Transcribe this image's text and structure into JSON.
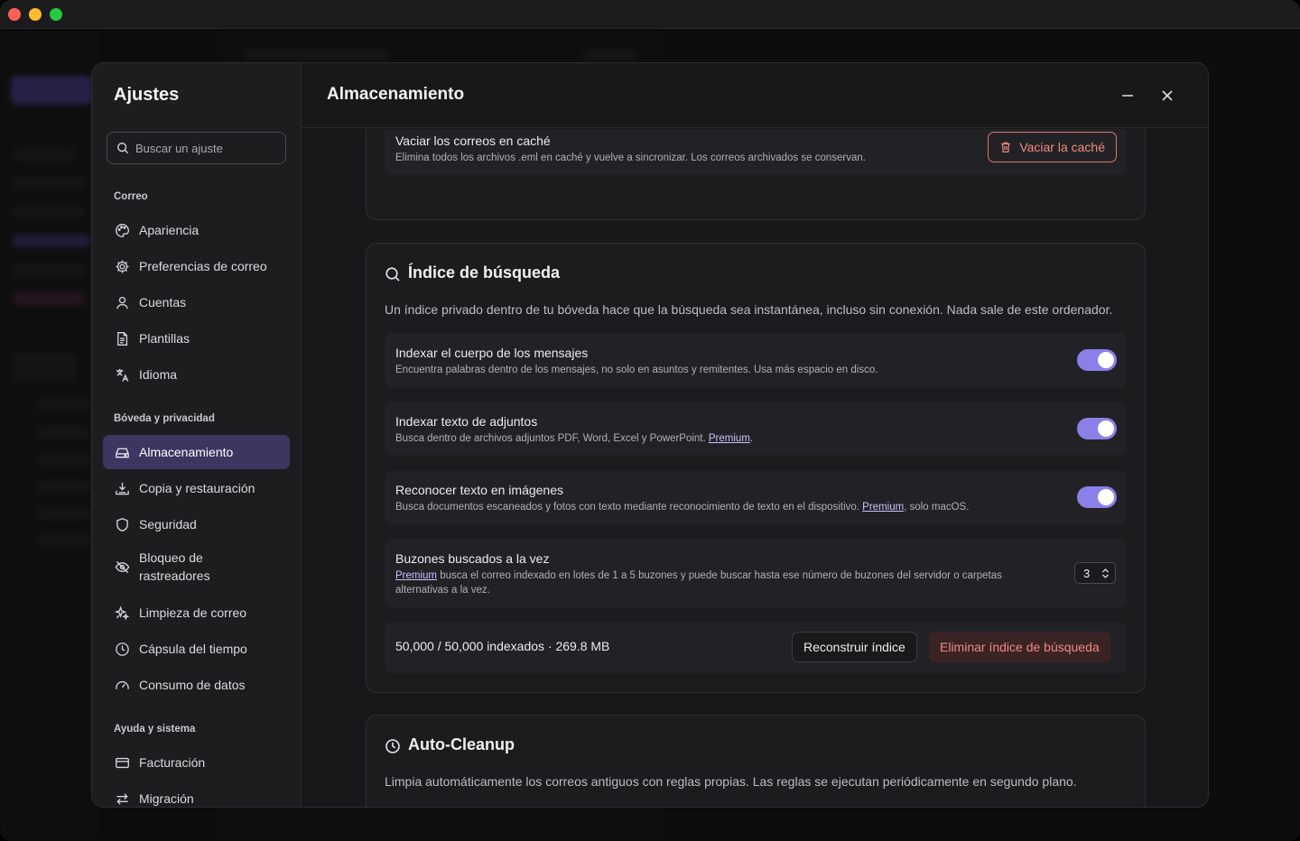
{
  "settings": {
    "title": "Ajustes",
    "search_placeholder": "Buscar un ajuste",
    "sections": [
      {
        "label": "Correo"
      },
      {
        "label": "Bóveda y privacidad"
      },
      {
        "label": "Ayuda y sistema"
      }
    ],
    "nav": {
      "apariencia": "Apariencia",
      "preferencias": "Preferencias de correo",
      "cuentas": "Cuentas",
      "plantillas": "Plantillas",
      "idioma": "Idioma",
      "almacenamiento": "Almacenamiento",
      "copia": "Copia y restauración",
      "seguridad": "Seguridad",
      "bloqueo": "Bloqueo de rastreadores",
      "limpieza": "Limpieza de correo",
      "capsula": "Cápsula del tiempo",
      "consumo": "Consumo de datos",
      "facturacion": "Facturación",
      "migracion": "Migración"
    }
  },
  "page": {
    "title": "Almacenamiento"
  },
  "cache": {
    "title": "Vaciar los correos en caché",
    "desc": "Elimina todos los archivos .eml en caché y vuelve a sincronizar. Los correos archivados se conservan.",
    "button": "Vaciar la caché"
  },
  "search_index": {
    "title": "Índice de búsqueda",
    "desc": "Un índice privado dentro de tu bóveda hace que la búsqueda sea instantánea, incluso sin conexión. Nada sale de este ordenador.",
    "body": {
      "title": "Indexar el cuerpo de los mensajes",
      "desc": "Encuentra palabras dentro de los mensajes, no solo en asuntos y remitentes. Usa más espacio en disco.",
      "enabled": true
    },
    "attachments": {
      "title": "Indexar texto de adjuntos",
      "desc": "Busca dentro de archivos adjuntos PDF, Word, Excel y PowerPoint.",
      "link": "Premium",
      "suffix": ".",
      "enabled": true
    },
    "images": {
      "title": "Reconocer texto en imágenes",
      "desc": "Busca documentos escaneados y fotos con texto mediante reconocimiento de texto en el dispositivo.",
      "link": "Premium",
      "suffix": ", solo macOS.",
      "enabled": true
    },
    "mailboxes": {
      "title": "Buzones buscados a la vez",
      "link": "Premium",
      "desc": "busca el correo indexado en lotes de 1 a 5 buzones y puede buscar hasta ese número de buzones del servidor o carpetas alternativas a la vez.",
      "value": "3"
    },
    "status": "50,000 / 50,000 indexados · 269.8 MB",
    "rebuild": "Reconstruir índice",
    "delete": "Eliminar índice de búsqueda"
  },
  "auto_cleanup": {
    "title": "Auto-Cleanup",
    "desc": "Limpia automáticamente los correos antiguos con reglas propias. Las reglas se ejecutan periódicamente en segundo plano."
  },
  "colors": {
    "accent": "#8b80e8",
    "danger": "#f08a80",
    "active_nav": "#3b3760"
  }
}
